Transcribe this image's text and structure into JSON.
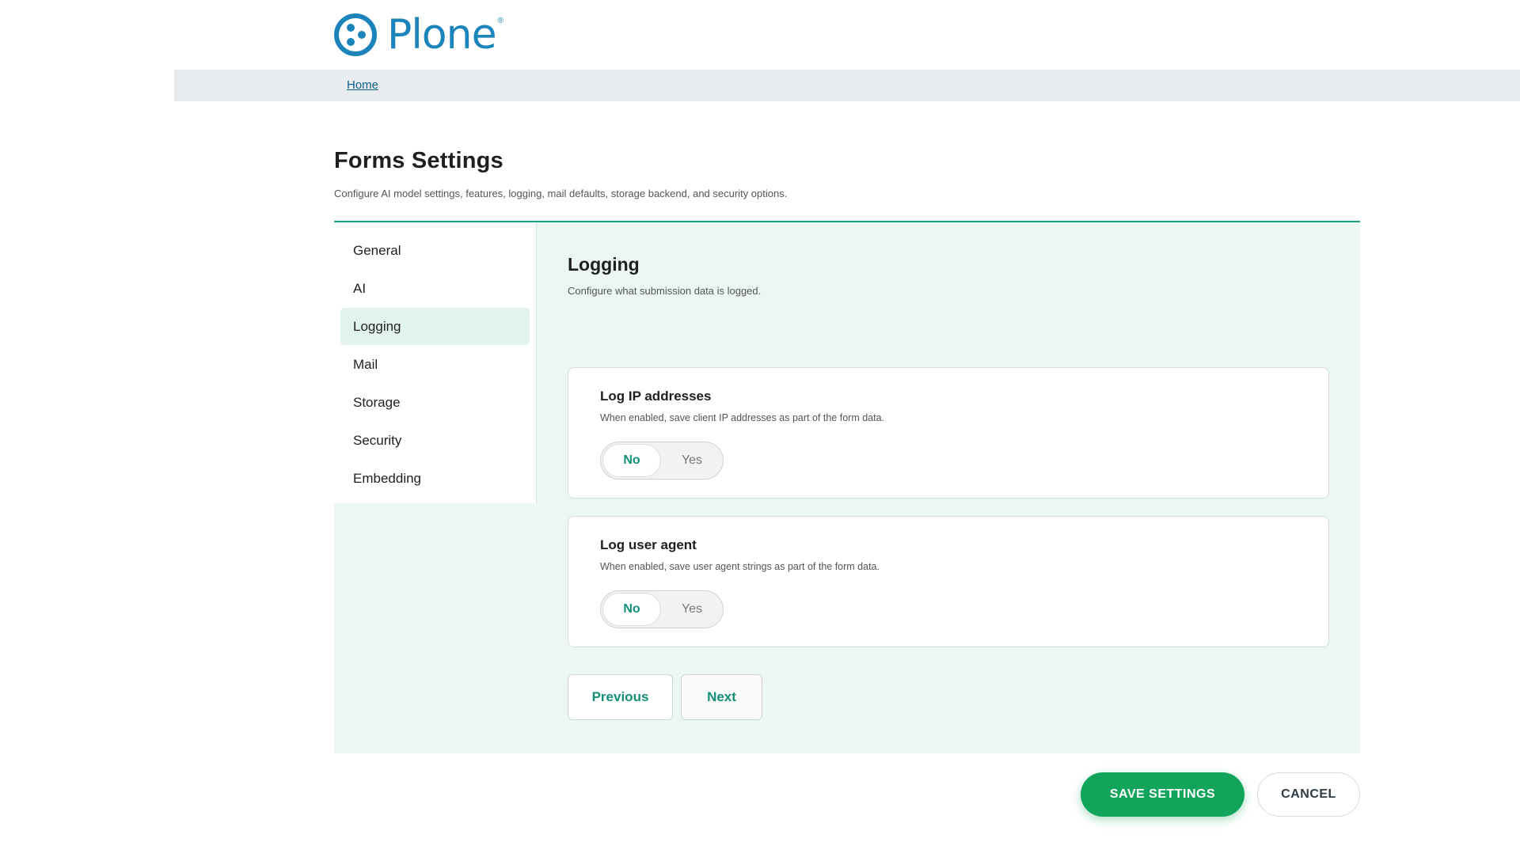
{
  "header": {
    "logo_text": "Plone",
    "logo_reg": "®",
    "logo_icon": "plone-logo-icon",
    "brand_color": "#1b84ba"
  },
  "breadcrumb": {
    "home": "Home"
  },
  "page": {
    "title": "Forms Settings",
    "description": "Configure AI model settings, features, logging, mail defaults, storage backend, and security options."
  },
  "sidebar": {
    "items": [
      {
        "label": "General",
        "active": false
      },
      {
        "label": "AI",
        "active": false
      },
      {
        "label": "Logging",
        "active": true
      },
      {
        "label": "Mail",
        "active": false
      },
      {
        "label": "Storage",
        "active": false
      },
      {
        "label": "Security",
        "active": false
      },
      {
        "label": "Embedding",
        "active": false
      }
    ]
  },
  "section": {
    "title": "Logging",
    "description": "Configure what submission data is logged.",
    "settings": [
      {
        "title": "Log IP addresses",
        "description": "When enabled, save client IP addresses as part of the form data.",
        "options": [
          "No",
          "Yes"
        ],
        "selected": "No"
      },
      {
        "title": "Log user agent",
        "description": "When enabled, save user agent strings as part of the form data.",
        "options": [
          "No",
          "Yes"
        ],
        "selected": "No"
      }
    ]
  },
  "wizard": {
    "previous_label": "Previous",
    "next_label": "Next"
  },
  "actions": {
    "save_label": "SAVE SETTINGS",
    "cancel_label": "CANCEL"
  },
  "colors": {
    "accent": "#138f78",
    "save": "#12a45a",
    "panel_bg": "#ecf7f4"
  }
}
